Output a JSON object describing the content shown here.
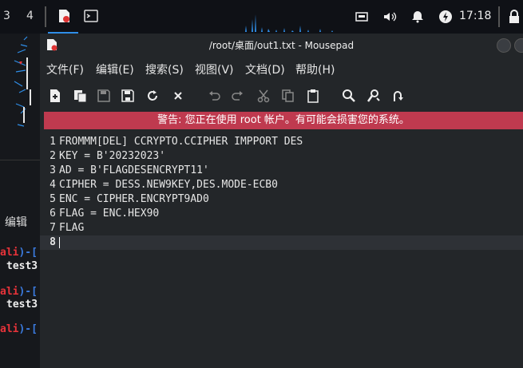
{
  "panel": {
    "workspaces": [
      "3",
      "4"
    ],
    "clock": "17:18"
  },
  "background_terminal": {
    "menu_label": "编辑",
    "prompt_user": "ali",
    "prompt_bracket": ")-[",
    "command_fragment": "test3"
  },
  "window": {
    "title": "/root/桌面/out1.txt - Mousepad",
    "menu": [
      "文件(F)",
      "编辑(E)",
      "搜索(S)",
      "视图(V)",
      "文档(D)",
      "帮助(H)"
    ],
    "toolbar": [
      "new-document-icon",
      "new-window-icon",
      "save-icon",
      "save-as-icon",
      "reload-icon",
      "close-icon",
      "undo-icon",
      "redo-icon",
      "cut-icon",
      "copy-icon",
      "paste-icon",
      "find-icon",
      "find-replace-icon",
      "goto-line-icon"
    ],
    "warning": "警告: 您正在使用 root 帐户。有可能会损害您的系统。",
    "lines": [
      {
        "n": "1",
        "text": "FROMMM[DEL] CCRYPTO.CCIPHER IMPPORT DES"
      },
      {
        "n": "2",
        "text": "KEY = B'20232023'"
      },
      {
        "n": "3",
        "text": "AD = B'FLAGDESENCRYPT11'"
      },
      {
        "n": "4",
        "text": "CIPHER = DESS.NEW9KEY,DES.MODE-ECB0"
      },
      {
        "n": "5",
        "text": "ENC = CIPHER.ENCRYPT9AD0"
      },
      {
        "n": "6",
        "text": "FLAG = ENC.HEX90"
      },
      {
        "n": "7",
        "text": "FLAG"
      },
      {
        "n": "8",
        "text": ""
      }
    ]
  },
  "colors": {
    "warning_bg": "#bf3a4f",
    "accent": "#2f8ee8",
    "prompt_red": "#e8333a"
  }
}
